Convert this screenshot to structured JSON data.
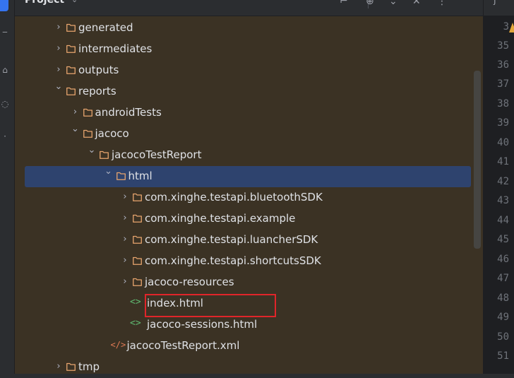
{
  "panel": {
    "title": "Project",
    "title_chevron": "⌄",
    "header_icons": [
      "scope-icon",
      "target-icon",
      "collapse-icon",
      "close-icon",
      "more-icon"
    ]
  },
  "tree": {
    "rows": [
      {
        "label": "generated",
        "type": "folder",
        "expanded": false
      },
      {
        "label": "intermediates",
        "type": "folder",
        "expanded": false
      },
      {
        "label": "outputs",
        "type": "folder",
        "expanded": false
      },
      {
        "label": "reports",
        "type": "folder",
        "expanded": true
      },
      {
        "label": "androidTests",
        "type": "folder",
        "expanded": false
      },
      {
        "label": "jacoco",
        "type": "folder",
        "expanded": true
      },
      {
        "label": "jacocoTestReport",
        "type": "folder",
        "expanded": true
      },
      {
        "label": "html",
        "type": "folder",
        "expanded": true,
        "selected": true
      },
      {
        "label": "com.xinghe.testapi.bluetoothSDK",
        "type": "folder",
        "expanded": false
      },
      {
        "label": "com.xinghe.testapi.example",
        "type": "folder",
        "expanded": false
      },
      {
        "label": "com.xinghe.testapi.luancherSDK",
        "type": "folder",
        "expanded": false
      },
      {
        "label": "com.xinghe.testapi.shortcutsSDK",
        "type": "folder",
        "expanded": false
      },
      {
        "label": "jacoco-resources",
        "type": "folder",
        "expanded": false
      },
      {
        "label": "index.html",
        "type": "html-file",
        "highlighted": true
      },
      {
        "label": "jacoco-sessions.html",
        "type": "html-file"
      },
      {
        "label": "jacocoTestReport.xml",
        "type": "xml-file"
      },
      {
        "label": "tmp",
        "type": "folder",
        "expanded": false
      }
    ]
  },
  "gutter": {
    "tab_label": "j",
    "line_numbers": [
      "3",
      "35",
      "36",
      "37",
      "38",
      "39",
      "40",
      "41",
      "42",
      "43",
      "44",
      "45",
      "46",
      "47",
      "48",
      "49",
      "50",
      "51"
    ]
  },
  "colors": {
    "panel_bg": "#3b3224",
    "selection": "#2e436e",
    "highlight_border": "#e0252a",
    "folder_stroke": "#e8a56e",
    "html_icon": "#5fb870",
    "xml_icon": "#e07a55"
  }
}
